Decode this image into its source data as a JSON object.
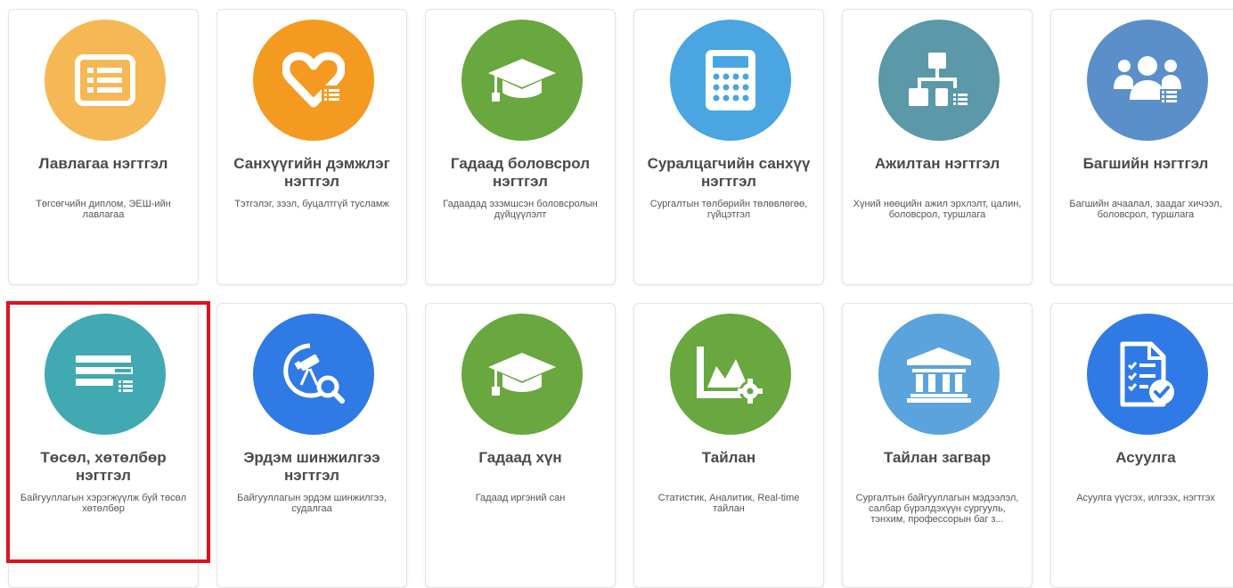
{
  "colors": {
    "yellow": "#f5b854",
    "orange": "#f49a20",
    "green": "#69a73f",
    "light_blue": "#4aa5e0",
    "teal_gray": "#5b98a8",
    "steel_blue": "#5b8fc9",
    "teal": "#41a9b1",
    "royal_blue": "#2f7ae5",
    "sky_blue": "#5aa3dd",
    "highlight_red": "#e0131b"
  },
  "modules": [
    {
      "title": "Лавлагаа нэгтгэл",
      "desc": "Төгсөгчийн диплом, ЭЕШ-ийн лавлагаа",
      "icon": "list-icon"
    },
    {
      "title": "Санхүүгийн дэмжлэг нэгтгэл",
      "desc": "Тэтгэлэг, зээл, буцалтгүй тусламж",
      "icon": "heart-icon"
    },
    {
      "title": "Гадаад боловсрол нэгтгэл",
      "desc": "Гадаадад эзэмшсэн боловсролын дүйцүүлэлт",
      "icon": "graduation-cap-icon"
    },
    {
      "title": "Суралцагчийн санхүү нэгтгэл",
      "desc": "Сургалтын төлбөрийн төлөвлөгөө, гүйцэтгэл",
      "icon": "calculator-icon"
    },
    {
      "title": "Ажилтан нэгтгэл",
      "desc": "Хүний нөөцийн ажил эрхлэлт, цалин, боловсрол, туршлага",
      "icon": "org-chart-icon"
    },
    {
      "title": "Багшийн нэгтгэл",
      "desc": "Багшийн ачаалал, заадаг хичээл, боловсрол, туршлага",
      "icon": "users-icon"
    },
    {
      "title": "Төсөл, хөтөлбөр нэгтгэл",
      "desc": "Байгууллагын хэрэгжүүлж буй төсөл хөтөлбөр",
      "icon": "project-bars-icon"
    },
    {
      "title": "Эрдэм шинжилгээ нэгтгэл",
      "desc": "Байгууллагын эрдэм шинжилгээ, судалгаа",
      "icon": "telescope-search-icon"
    },
    {
      "title": "Гадаад хүн",
      "desc": "Гадаад иргэний сан",
      "icon": "graduation-cap-icon"
    },
    {
      "title": "Тайлан",
      "desc": "Статистик, Аналитик, Real-time тайлан",
      "icon": "chart-gear-icon"
    },
    {
      "title": "Тайлан загвар",
      "desc": "Сургалтын байгууллагын мэдээлэл, салбар бүрэлдэхүүн сургууль, тэнхим, профессорын баг з...",
      "icon": "institution-icon"
    },
    {
      "title": "Асуулга",
      "desc": "Асуулга үүсгэх, илгээх, нэгтгэх",
      "icon": "checklist-icon"
    }
  ]
}
